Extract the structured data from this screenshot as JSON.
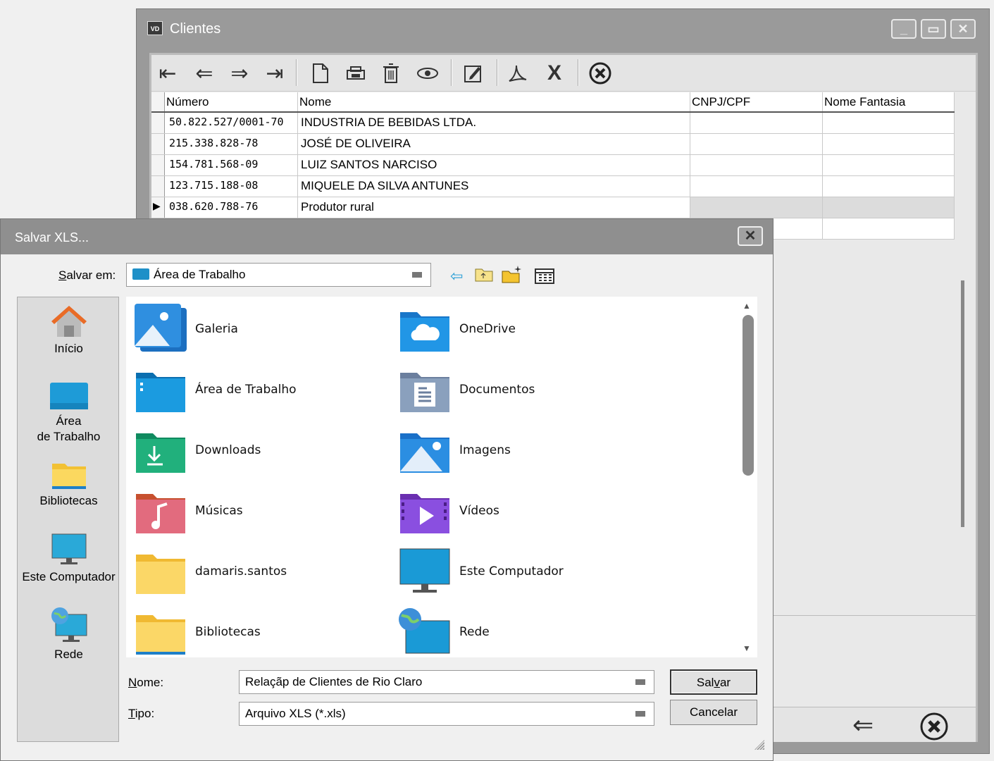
{
  "clientes_window": {
    "app_icon_text": "VD",
    "title": "Clientes",
    "table": {
      "columns": [
        "Número",
        "Nome",
        "CNPJ/CPF",
        "Nome Fantasia"
      ],
      "rows": [
        {
          "numero": "50.822.527/0001-70",
          "nome": "INDUSTRIA DE BEBIDAS LTDA.",
          "cnpj": "",
          "fantasia": ""
        },
        {
          "numero": "215.338.828-78",
          "nome": "JOSÉ DE OLIVEIRA",
          "cnpj": "",
          "fantasia": ""
        },
        {
          "numero": "154.781.568-09",
          "nome": "LUIZ SANTOS NARCISO",
          "cnpj": "",
          "fantasia": ""
        },
        {
          "numero": "123.715.188-08",
          "nome": "MIQUELE DA SILVA ANTUNES",
          "cnpj": "",
          "fantasia": ""
        },
        {
          "numero": "038.620.788-76",
          "nome": "Produtor rural",
          "cnpj": "",
          "fantasia": ""
        }
      ],
      "selected_row_marker": "▶"
    }
  },
  "save_dialog": {
    "title": "Salvar XLS...",
    "close_label": "✕",
    "save_in": {
      "label_accel": "S",
      "label_rest": "alvar em:",
      "value": "Área de Trabalho"
    },
    "places": [
      {
        "label": "Início"
      },
      {
        "label": "Área\nde Trabalho"
      },
      {
        "label": "Bibliotecas"
      },
      {
        "label": "Este Computador"
      },
      {
        "label": "Rede"
      }
    ],
    "files": [
      {
        "name": "Galeria"
      },
      {
        "name": "OneDrive"
      },
      {
        "name": "Área de Trabalho"
      },
      {
        "name": "Documentos"
      },
      {
        "name": "Downloads"
      },
      {
        "name": "Imagens"
      },
      {
        "name": "Músicas"
      },
      {
        "name": "Vídeos"
      },
      {
        "name": "damaris.santos"
      },
      {
        "name": "Este Computador"
      },
      {
        "name": "Bibliotecas"
      },
      {
        "name": "Rede"
      }
    ],
    "filename": {
      "label_accel": "N",
      "label_rest": "ome:",
      "value": "Relaçãp de Clientes de Rio Claro"
    },
    "filetype": {
      "label_accel": "T",
      "label_rest": "ipo:",
      "value": "Arquivo XLS (*.xls)"
    },
    "save_button": {
      "before": "Sal",
      "accel": "v",
      "after": "ar"
    },
    "cancel_button": "Cancelar"
  }
}
